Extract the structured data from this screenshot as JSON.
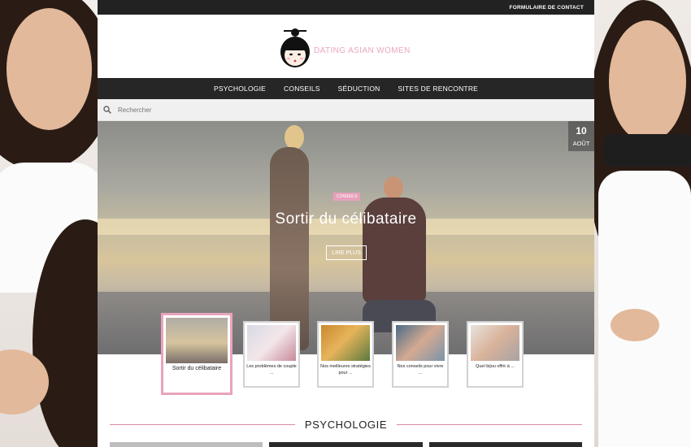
{
  "topbar": {
    "contact_link": "FORMULAIRE DE CONTACT"
  },
  "logo": {
    "text": "DATING ASIAN WOMEN"
  },
  "nav": {
    "items": [
      {
        "label": "PSYCHOLOGIE"
      },
      {
        "label": "CONSEILS"
      },
      {
        "label": "SÉDUCTION"
      },
      {
        "label": "SITES DE RENCONTRE"
      }
    ]
  },
  "search": {
    "placeholder": "Rechercher"
  },
  "hero": {
    "date_day": "10",
    "date_month": "AOÛT",
    "tag": "CONSEILS",
    "title": "Sortir du célibataire",
    "button": "LIRE PLUS"
  },
  "thumbnails": [
    {
      "caption": "Sortir du célibataire"
    },
    {
      "caption": "Les problèmes de couple ..."
    },
    {
      "caption": "Nos meilleures stratégies pour ..."
    },
    {
      "caption": "Nos conseils pour vivre ..."
    },
    {
      "caption": "Quel bijou offrir à ..."
    }
  ],
  "section": {
    "title": "PSYCHOLOGIE"
  },
  "colors": {
    "accent_pink": "#e9a4bd",
    "dark_nav": "#262626"
  }
}
